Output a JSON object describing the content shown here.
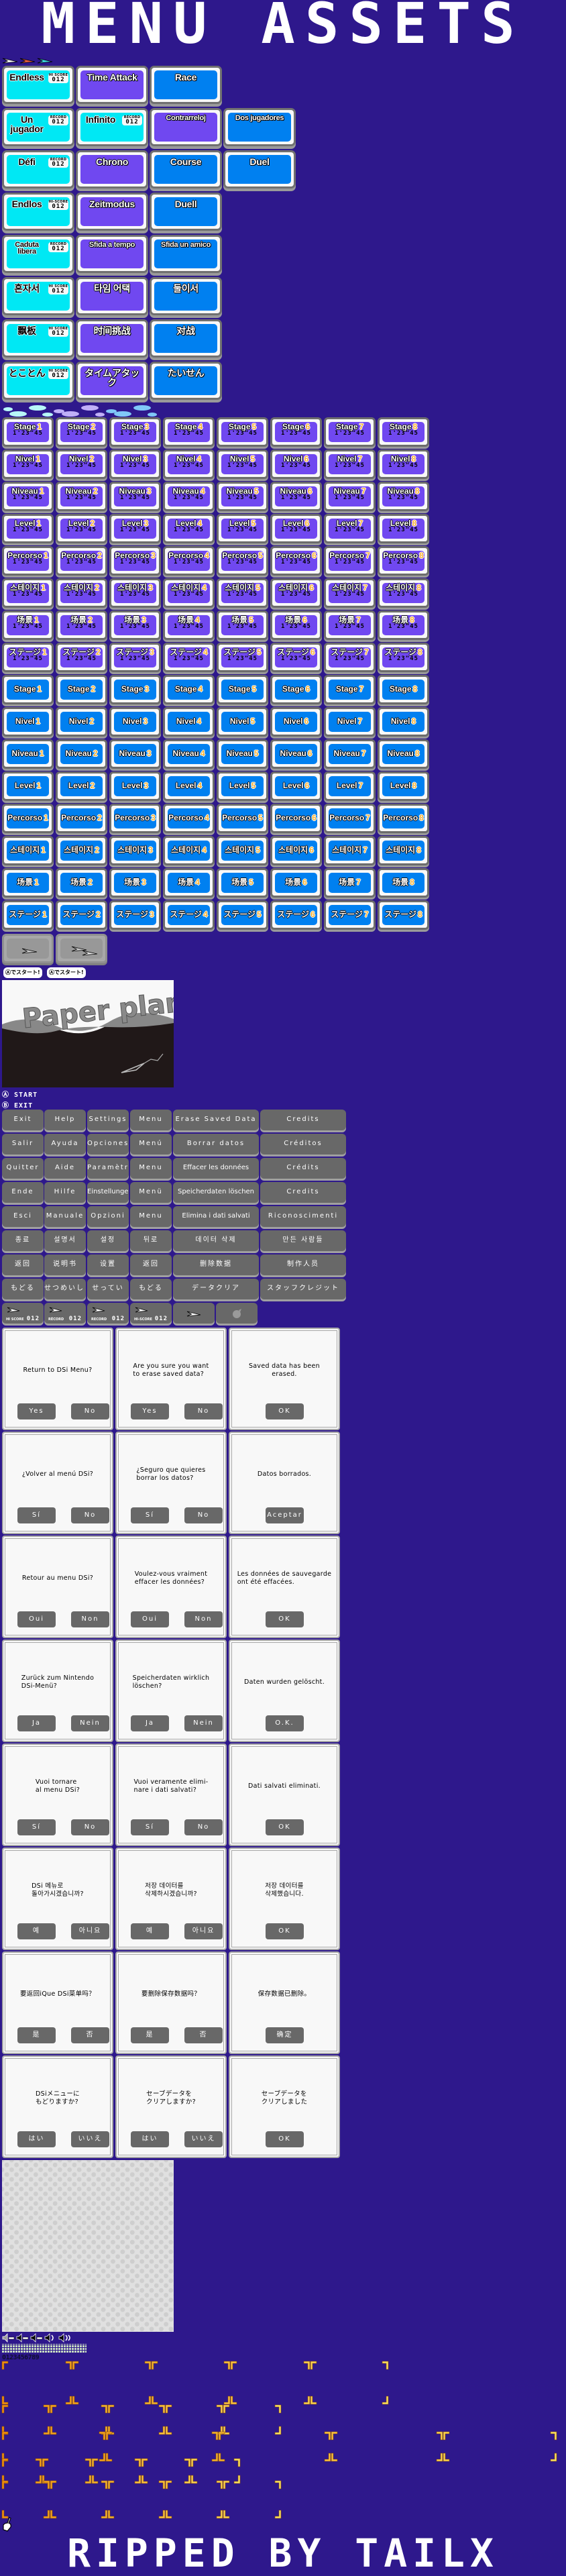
{
  "header": {
    "title": "MENU ASSETS"
  },
  "footer": {
    "credit": "RIPPED BY TAILX"
  },
  "colors": {
    "background": "#2e188c",
    "endless": "#00e8f4",
    "time_attack": "#7048f0",
    "versus": "#0080f0",
    "gray_button": "#686868",
    "stage_number": "#f8b030"
  },
  "plane_icons": [
    {
      "icon": "paper-plane-icon",
      "color": "#ffffff"
    },
    {
      "icon": "paper-plane-icon",
      "color": "#f06040"
    },
    {
      "icon": "paper-plane-icon",
      "color": "#40e0e8"
    }
  ],
  "mode_menu": {
    "rows": [
      [
        {
          "label": "Endless",
          "color": "endless",
          "badge": "HI SCORE",
          "score": "012"
        },
        {
          "label": "Time Attack",
          "color": "time_attack"
        },
        {
          "label": "Race",
          "color": "versus"
        }
      ],
      [
        {
          "label": "Un jugador",
          "color": "endless",
          "badge": "RÉCORD",
          "score": "012"
        },
        {
          "label": "Infinito",
          "color": "endless",
          "badge": "RÉCORD",
          "score": "012"
        },
        {
          "label": "Contrarreloj",
          "color": "time_attack"
        },
        {
          "label": "Dos jugadores",
          "color": "versus"
        }
      ],
      [
        {
          "label": "Défi",
          "color": "endless",
          "badge": "RECORD",
          "score": "012"
        },
        {
          "label": "Chrono",
          "color": "time_attack"
        },
        {
          "label": "Course",
          "color": "versus"
        },
        {
          "label": "Duel",
          "color": "versus"
        }
      ],
      [
        {
          "label": "Endlos",
          "color": "endless",
          "badge": "HI-SCORE",
          "score": "012"
        },
        {
          "label": "Zeitmodus",
          "color": "time_attack"
        },
        {
          "label": "Duell",
          "color": "versus"
        }
      ],
      [
        {
          "label": "Caduta\nlibera",
          "color": "endless",
          "badge": "RECORD",
          "score": "012"
        },
        {
          "label": "Sfida a tempo",
          "color": "time_attack"
        },
        {
          "label": "Sfida un amico",
          "color": "versus"
        }
      ],
      [
        {
          "label": "혼자서",
          "color": "endless",
          "badge": "HI SCORE",
          "score": "012"
        },
        {
          "label": "타임 어택",
          "color": "time_attack"
        },
        {
          "label": "둘이서",
          "color": "versus"
        }
      ],
      [
        {
          "label": "飘板",
          "color": "endless",
          "badge": "HI SCORE",
          "score": "012"
        },
        {
          "label": "时间挑战",
          "color": "time_attack"
        },
        {
          "label": "对战",
          "color": "versus"
        }
      ],
      [
        {
          "label": "とことん",
          "color": "endless",
          "badge": "HI SCORE",
          "score": "012"
        },
        {
          "label": "タイムアタック",
          "color": "time_attack"
        },
        {
          "label": "たいせん",
          "color": "versus"
        }
      ]
    ]
  },
  "stage_grid": {
    "labels": [
      "Stage",
      "Nivel",
      "Niveau",
      "Level",
      "Percorso",
      "스테이지",
      "场景",
      "ステージ"
    ],
    "numbers": [
      "1",
      "2",
      "3",
      "4",
      "5",
      "6",
      "7",
      "8"
    ],
    "time": "1'23\"45",
    "timed_color": "#7048f0",
    "plain_color": "#0080f0"
  },
  "start_bubbles": [
    "Ⓐでスタート!",
    "Ⓐでスタート!"
  ],
  "title_screen": {
    "logo_text": "Paper plane"
  },
  "prompts": {
    "start": "Ⓐ START",
    "exit": "Ⓑ EXIT"
  },
  "system_buttons": {
    "rows": [
      [
        "Exit",
        "Help",
        "Settings",
        "Menu",
        "Erase Saved Data",
        "Credits"
      ],
      [
        "Salir",
        "Ayuda",
        "Opciones",
        "Menú",
        "Borrar datos",
        "Créditos"
      ],
      [
        "Quitter",
        "Aide",
        "Paramètres",
        "Menu",
        "Effacer les données",
        "Crédits"
      ],
      [
        "Ende",
        "Hilfe",
        "Einstellungen",
        "Menü",
        "Speicherdaten löschen",
        "Credits"
      ],
      [
        "Esci",
        "Manuale",
        "Opzioni",
        "Menu",
        "Elimina i dati salvati",
        "Riconoscimenti"
      ],
      [
        "종료",
        "설명서",
        "설정",
        "뒤로",
        "데이터 삭제",
        "만든 사람들"
      ],
      [
        "返回",
        "说明书",
        "设置",
        "返回",
        "删除数据",
        "制作人员"
      ],
      [
        "もどる",
        "せつめいしょ",
        "せってい",
        "もどる",
        "データクリア",
        "スタッフクレジット"
      ]
    ],
    "score_buttons": [
      {
        "badge": "HI SCORE",
        "score": "012"
      },
      {
        "badge": "RÉCORD",
        "score": "012"
      },
      {
        "badge": "RECORD",
        "score": "012"
      },
      {
        "badge": "HI-SCORE",
        "score": "012"
      }
    ]
  },
  "dialogs": [
    [
      {
        "message": "Return to DSi Menu?",
        "buttons": [
          "Yes",
          "No"
        ]
      },
      {
        "message": "Are you sure you want\nto erase saved data?",
        "buttons": [
          "Yes",
          "No"
        ]
      },
      {
        "message": "Saved data has been erased.",
        "buttons": [
          "OK"
        ]
      }
    ],
    [
      {
        "message": "¿Volver al menú DSi?",
        "buttons": [
          "Sí",
          "No"
        ]
      },
      {
        "message": "¿Seguro que quieres\nborrar los datos?",
        "buttons": [
          "Sí",
          "No"
        ]
      },
      {
        "message": "Datos borrados.",
        "buttons": [
          "Aceptar"
        ]
      }
    ],
    [
      {
        "message": "Retour au menu DSi?",
        "buttons": [
          "Oui",
          "Non"
        ]
      },
      {
        "message": "Voulez-vous vraiment\neffacer les données?",
        "buttons": [
          "Oui",
          "Non"
        ]
      },
      {
        "message": "Les données de sauvegarde\nont été effacées.",
        "buttons": [
          "OK"
        ]
      }
    ],
    [
      {
        "message": "Zurück zum Nintendo\nDSi-Menü?",
        "buttons": [
          "Ja",
          "Nein"
        ]
      },
      {
        "message": "Speicherdaten wirklich\nlöschen?",
        "buttons": [
          "Ja",
          "Nein"
        ]
      },
      {
        "message": "Daten wurden gelöscht.",
        "buttons": [
          "O.K."
        ]
      }
    ],
    [
      {
        "message": "Vuoi tornare\nal menu DSi?",
        "buttons": [
          "Sí",
          "No"
        ]
      },
      {
        "message": "Vuoi veramente elimi-\nnare i dati salvati?",
        "buttons": [
          "Sí",
          "No"
        ]
      },
      {
        "message": "Dati salvati eliminati.",
        "buttons": [
          "OK"
        ]
      }
    ],
    [
      {
        "message": "DSi 메뉴로\n돌아가시겠습니까?",
        "buttons": [
          "예",
          "아니요"
        ]
      },
      {
        "message": "저장 데이터를\n삭제하시겠습니까?",
        "buttons": [
          "예",
          "아니요"
        ]
      },
      {
        "message": "저장 데이터를\n삭제했습니다.",
        "buttons": [
          "OK"
        ]
      }
    ],
    [
      {
        "message": "要返回iQue DSi菜单吗？",
        "buttons": [
          "是",
          "否"
        ]
      },
      {
        "message": "要删除保存数据吗？",
        "buttons": [
          "是",
          "否"
        ]
      },
      {
        "message": "保存数据已删除。",
        "buttons": [
          "确定"
        ]
      }
    ],
    [
      {
        "message": "DSiメニューに\nもどりますか?",
        "buttons": [
          "はい",
          "いいえ"
        ]
      },
      {
        "message": "セーブデータを\nクリアしますか?",
        "buttons": [
          "はい",
          "いいえ"
        ]
      },
      {
        "message": "セーブデータを\nクリアしました",
        "buttons": [
          "OK"
        ]
      }
    ]
  ],
  "volume_levels": [
    0,
    1,
    2,
    3,
    4
  ],
  "digit_strip": "0123456789"
}
